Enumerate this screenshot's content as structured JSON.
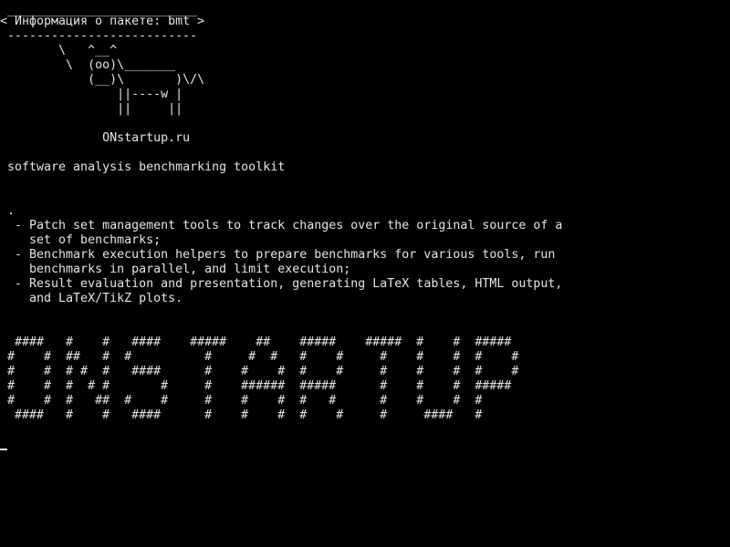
{
  "terminal": {
    "lines": [
      " __________________________",
      "< Информация о пакете: bmt >",
      " --------------------------",
      "        \\   ^__^",
      "         \\  (oo)\\_______",
      "            (__)\\       )\\/\\",
      "                ||----w |",
      "                ||     ||",
      "",
      "              ONstartup.ru",
      "",
      " software analysis benchmarking toolkit",
      "",
      "",
      " .",
      "  - Patch set management tools to track changes over the original source of a",
      "    set of benchmarks;",
      "  - Benchmark execution helpers to prepare benchmarks for various tools, run",
      "    benchmarks in parallel, and limit execution;",
      "  - Result evaluation and presentation, generating LaTeX tables, HTML output,",
      "    and LaTeX/TikZ plots.",
      "",
      "",
      "  ####   #    #   ####    #####    ##    #####    #####  #    #  #####",
      " #    #  ##   #  #          #     #  #   #    #     #    #    #  #    #",
      " #    #  # #  #   ####      #    #    #  #    #     #    #    #  #    #",
      " #    #  #  # #       #     #    ######  #####      #    #    #  #####",
      " #    #  #   ##  #    #     #    #    #  #   #      #    #    #  #",
      "  ####   #    #   ####      #    #    #  #    #     #     ####   #"
    ]
  }
}
